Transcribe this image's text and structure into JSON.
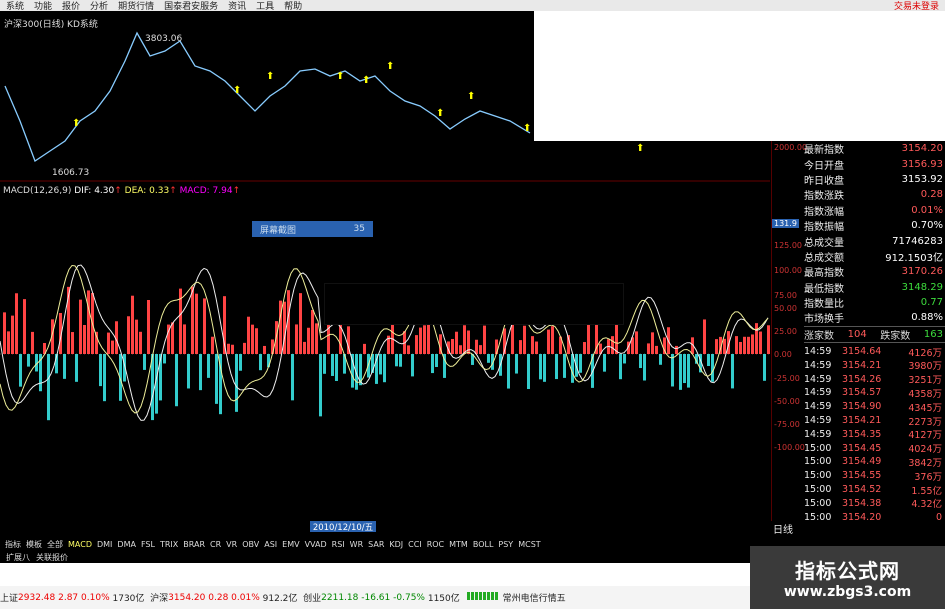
{
  "menu": {
    "items": [
      "系统",
      "功能",
      "报价",
      "分析",
      "期货行情",
      "国泰君安服务",
      "资讯",
      "工具",
      "帮助"
    ],
    "trade": "交易未登录"
  },
  "kline": {
    "title": "沪深300(日线) KD系统",
    "high_label": "3803.06",
    "low_label": "1606.73"
  },
  "macd_header": {
    "name": "MACD(12,26,9)",
    "dif": "DIF: 4.30",
    "dea": "DEA: 0.33",
    "macd": "MACD: 7.94"
  },
  "screenshot_box": {
    "label": "屏幕截图",
    "value": "35"
  },
  "axis": {
    "top_tag": "131.9",
    "ticks": [
      "2000.00",
      "125.00",
      "100.00",
      "75.00",
      "50.00",
      "25.00",
      "0.00",
      "-25.00",
      "-50.00",
      "-75.00",
      "-100.00"
    ]
  },
  "index_info": [
    {
      "label": "最新指数",
      "value": "3154.20",
      "color": "r"
    },
    {
      "label": "今日开盘",
      "value": "3156.93",
      "color": "r"
    },
    {
      "label": "昨日收盘",
      "value": "3153.92",
      "color": "w"
    },
    {
      "label": "指数涨跌",
      "value": "0.28",
      "color": "r"
    },
    {
      "label": "指数涨幅",
      "value": "0.01%",
      "color": "r"
    },
    {
      "label": "指数振幅",
      "value": "0.70%",
      "color": "w"
    },
    {
      "label": "总成交量",
      "value": "71746283",
      "color": "w"
    },
    {
      "label": "总成交额",
      "value": "912.1503亿",
      "color": "w"
    },
    {
      "label": "最高指数",
      "value": "3170.26",
      "color": "r"
    },
    {
      "label": "最低指数",
      "value": "3148.29",
      "color": "g"
    },
    {
      "label": "指数量比",
      "value": "0.77",
      "color": "g"
    },
    {
      "label": "市场换手",
      "value": "0.88%",
      "color": "w"
    }
  ],
  "adv_dec": {
    "up_label": "涨家数",
    "up": "104",
    "down_label": "跌家数",
    "down": "163"
  },
  "ticks": [
    {
      "t": "14:59",
      "p": "3154.64",
      "v": "4126万"
    },
    {
      "t": "14:59",
      "p": "3154.21",
      "v": "3980万"
    },
    {
      "t": "14:59",
      "p": "3154.26",
      "v": "3251万"
    },
    {
      "t": "14:59",
      "p": "3154.57",
      "v": "4358万"
    },
    {
      "t": "14:59",
      "p": "3154.90",
      "v": "4345万"
    },
    {
      "t": "14:59",
      "p": "3154.21",
      "v": "2273万"
    },
    {
      "t": "14:59",
      "p": "3154.35",
      "v": "4127万"
    },
    {
      "t": "15:00",
      "p": "3154.45",
      "v": "4024万"
    },
    {
      "t": "15:00",
      "p": "3154.49",
      "v": "3842万"
    },
    {
      "t": "15:00",
      "p": "3154.55",
      "v": "376万"
    },
    {
      "t": "15:00",
      "p": "3154.52",
      "v": "1.55亿"
    },
    {
      "t": "15:00",
      "p": "3154.38",
      "v": "4.32亿"
    },
    {
      "t": "15:00",
      "p": "3154.20",
      "v": "0"
    }
  ],
  "date_tag": "2010/12/10/五",
  "day_button": "日线",
  "indicator_tabs": [
    "指标",
    "模板",
    "全部",
    "MACD",
    "DMI",
    "DMA",
    "FSL",
    "TRIX",
    "BRAR",
    "CR",
    "VR",
    "OBV",
    "ASI",
    "EMV",
    "VVAD",
    "RSI",
    "WR",
    "SAR",
    "KDJ",
    "CCI",
    "ROC",
    "MTM",
    "BOLL",
    "PSY",
    "MCST"
  ],
  "bottom_tabs": [
    "扩展八",
    "关联报价"
  ],
  "status": {
    "sh_label": "上证",
    "sh_val": "2932.48",
    "sh_chg": "2.87",
    "sh_pct": "0.10%",
    "sh_amt": "1730亿",
    "hs_label": "沪深",
    "hs_val": "3154.20",
    "hs_chg": "0.28",
    "hs_pct": "0.01%",
    "hs_amt": "912.2亿",
    "cy_label": "创业",
    "cy_val": "2211.18",
    "cy_chg": "-16.61",
    "cy_pct": "-0.75%",
    "cy_amt": "1150亿",
    "broker": "常州电信行情五"
  },
  "watermark": {
    "line1": "指标公式网",
    "line2": "www.zbgs3.com"
  }
}
